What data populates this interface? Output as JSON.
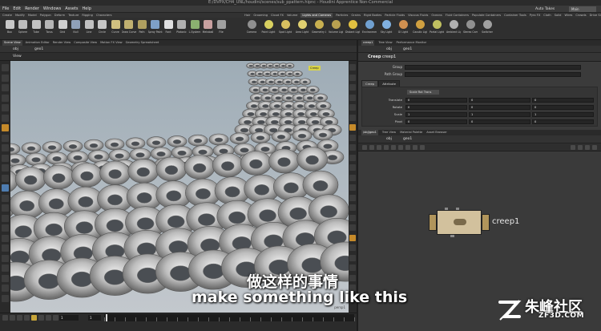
{
  "window": {
    "title": "E:/DVPX/CH4_UNL/houdini/scenes/sub_ppattern.hipnc - Houdini Apprentice Non-Commercial"
  },
  "menu": {
    "items": [
      "File",
      "Edit",
      "Render",
      "Windows",
      "Assets",
      "Help"
    ],
    "auto_takes": "Auto Takes",
    "profile": "Main"
  },
  "shelf": {
    "tabs": [
      "Create",
      "Modify",
      "Model",
      "Polygon",
      "Deform",
      "Texture",
      "Rigging",
      "Characters",
      "Hair",
      "Grooming",
      "Cloud FX",
      "Volume",
      "Lights and Cameras",
      "Particles",
      "Grains",
      "Rigid Bodies",
      "Particle Fluids",
      "Viscous Fluids",
      "Oceans",
      "Fluid Containers",
      "Populate Containers",
      "Container Tools",
      "Pyro FX",
      "Cloth",
      "Solid",
      "Wires",
      "Crowds",
      "Drive Simulation"
    ],
    "active_tab": "Lights and Cameras",
    "tools_left": [
      {
        "label": "Box",
        "color": "#c9c9c9"
      },
      {
        "label": "Sphere",
        "color": "#bdbdbd"
      },
      {
        "label": "Tube",
        "color": "#c2c2c2"
      },
      {
        "label": "Torus",
        "color": "#b5b5b5"
      },
      {
        "label": "Grid",
        "color": "#cfcfcf"
      },
      {
        "label": "Null",
        "color": "#8fa0b8"
      },
      {
        "label": "Line",
        "color": "#c0c0c0"
      },
      {
        "label": "Circle",
        "color": "#c6c6c6"
      },
      {
        "label": "Curve",
        "color": "#d0c080"
      },
      {
        "label": "Draw Curve",
        "color": "#c0b070"
      },
      {
        "label": "Path",
        "color": "#b0a060"
      },
      {
        "label": "Spray Paint",
        "color": "#7ea0c8"
      },
      {
        "label": "Font",
        "color": "#e0e0e0"
      },
      {
        "label": "Platonic",
        "color": "#b0b0b0"
      },
      {
        "label": "L-System",
        "color": "#8ab070"
      },
      {
        "label": "Metaball",
        "color": "#c8a0a0"
      },
      {
        "label": "File",
        "color": "#a0a0a0"
      }
    ],
    "tools_right": [
      {
        "label": "Camera",
        "color": "#909090"
      },
      {
        "label": "Point Light",
        "color": "#d8d060"
      },
      {
        "label": "Spot Light",
        "color": "#d8c060"
      },
      {
        "label": "Area Light",
        "color": "#e0d070"
      },
      {
        "label": "Geometry Light",
        "color": "#c8b050"
      },
      {
        "label": "Volume Light",
        "color": "#b8a050"
      },
      {
        "label": "Distant Light",
        "color": "#e0c040"
      },
      {
        "label": "Environment",
        "color": "#70a0d0"
      },
      {
        "label": "Sky Light",
        "color": "#80b0e0"
      },
      {
        "label": "GI Light",
        "color": "#d09050"
      },
      {
        "label": "Caustic Light",
        "color": "#d0a040"
      },
      {
        "label": "Portal Light",
        "color": "#c0c060"
      },
      {
        "label": "Ambient Light",
        "color": "#b0b0b0"
      },
      {
        "label": "Stereo Cam",
        "color": "#909090"
      },
      {
        "label": "Switcher",
        "color": "#a0a0a0"
      }
    ]
  },
  "viewer": {
    "tabs": [
      "Scene View",
      "Animation Editor",
      "Render View",
      "Composite View",
      "Motion FX View",
      "Geometry Spreadsheet"
    ],
    "active_tab": "Scene View",
    "path_obj": "obj",
    "path_geo": "geo1",
    "header_label": "View",
    "menu_label": "Creep",
    "perspective": "persp1"
  },
  "params": {
    "tabs": [
      "creep1",
      "Tree View",
      "Performance Monitor"
    ],
    "path_obj": "obj",
    "path_geo": "geo1",
    "node_type": "Creep",
    "node_name": "creep1",
    "group_label": "Group",
    "path_group_label": "Path Group",
    "subtabs": [
      "Creep",
      "Attribute"
    ],
    "xform_order": "Scale Rot Trans",
    "rows": [
      {
        "label": "Translate",
        "values": [
          "0",
          "0",
          "0"
        ]
      },
      {
        "label": "Rotate",
        "values": [
          "0",
          "0",
          "0"
        ]
      },
      {
        "label": "Scale",
        "values": [
          "1",
          "1",
          "1"
        ]
      },
      {
        "label": "Pivot",
        "values": [
          "0",
          "0",
          "0"
        ]
      }
    ]
  },
  "network": {
    "tabs": [
      "/obj/geo1",
      "Tree View",
      "Material Palette",
      "Asset Browser"
    ],
    "path_obj": "obj",
    "path_geo": "geo1",
    "node_label": "creep1"
  },
  "timeline": {
    "frame": "1",
    "start": "1"
  },
  "subtitles": {
    "chinese": "做这样的事情",
    "english": "make something like this"
  },
  "watermark": {
    "brand": "朱峰社区",
    "url": "ZF3D.COM"
  }
}
